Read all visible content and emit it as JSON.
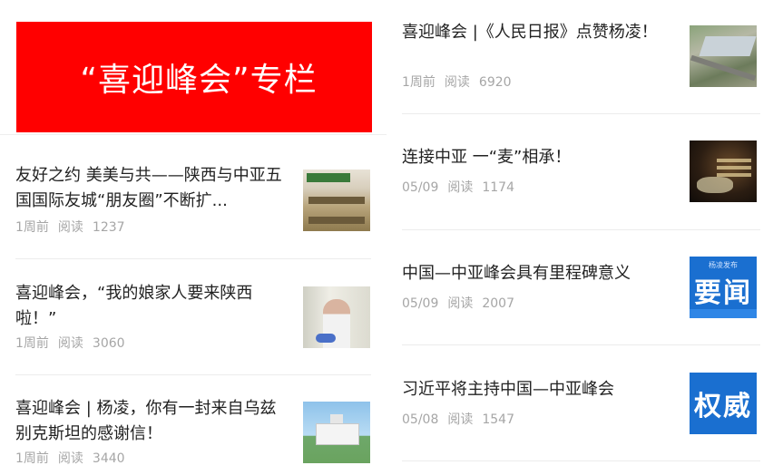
{
  "banner": {
    "title": "“喜迎峰会”专栏"
  },
  "left_articles": [
    {
      "title": "友好之约 美美与共——陕西与中亚五国国际友城“朋友圈”不断扩...",
      "time": "1周前",
      "read_label": "阅读",
      "reads": "1237",
      "thumb": "store-shelf-photo"
    },
    {
      "title": "喜迎峰会，“我的娘家人要来陕西啦！”",
      "time": "1周前",
      "read_label": "阅读",
      "reads": "3060",
      "thumb": "lab-worker-photo"
    },
    {
      "title": "喜迎峰会 | 杨凌，你有一封来自乌兹别克斯坦的感谢信！",
      "time": "1周前",
      "read_label": "阅读",
      "reads": "3440",
      "thumb": "building-photo"
    }
  ],
  "right_articles": [
    {
      "title": "喜迎峰会 |《人民日报》点赞杨凌！",
      "time": "1周前",
      "read_label": "阅读",
      "reads": "6920",
      "thumb": "aerial-photo"
    },
    {
      "title": "连接中亚 一“麦”相承！",
      "time": "05/09",
      "read_label": "阅读",
      "reads": "1174",
      "thumb": "wheat-dark-photo"
    },
    {
      "title": "中国—中亚峰会具有里程碑意义",
      "time": "05/09",
      "read_label": "阅读",
      "reads": "2007",
      "thumb": "yaowen-badge",
      "badge_text": "要闻",
      "badge_small": "杨凌发布"
    },
    {
      "title": "习近平将主持中国—中亚峰会",
      "time": "05/08",
      "read_label": "阅读",
      "reads": "1547",
      "thumb": "quanwei-badge",
      "badge_text": "权威"
    }
  ],
  "colors": {
    "banner": "#ff0000",
    "meta": "#a6a6a6",
    "badge": "#1a6fd0"
  }
}
